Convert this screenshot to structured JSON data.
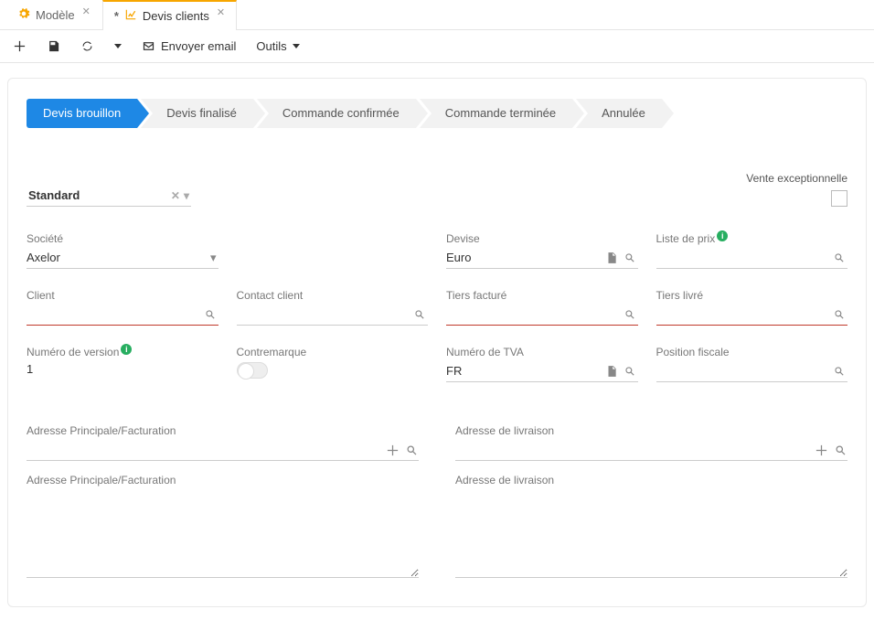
{
  "tabs": [
    {
      "label": "Modèle",
      "active": false,
      "icon": "gear"
    },
    {
      "label": "Devis clients",
      "active": true,
      "dirty_prefix": "*",
      "icon": "chart-line"
    }
  ],
  "toolbar": {
    "send_email": "Envoyer email",
    "tools": "Outils"
  },
  "workflow": [
    {
      "label": "Devis brouillon",
      "active": true
    },
    {
      "label": "Devis finalisé",
      "active": false
    },
    {
      "label": "Commande confirmée",
      "active": false
    },
    {
      "label": "Commande terminée",
      "active": false
    },
    {
      "label": "Annulée",
      "active": false
    }
  ],
  "header": {
    "standard_label": "Standard",
    "exceptional_sale_label": "Vente exceptionnelle"
  },
  "fields": {
    "company": {
      "label": "Société",
      "value": "Axelor"
    },
    "currency": {
      "label": "Devise",
      "value": "Euro"
    },
    "price_list": {
      "label": "Liste de prix",
      "value": ""
    },
    "client": {
      "label": "Client",
      "value": ""
    },
    "client_contact": {
      "label": "Contact client",
      "value": ""
    },
    "invoiced_third": {
      "label": "Tiers facturé",
      "value": ""
    },
    "delivered_third": {
      "label": "Tiers livré",
      "value": ""
    },
    "version_number": {
      "label": "Numéro de version",
      "value": "1"
    },
    "countermark": {
      "label": "Contremarque"
    },
    "vat_number": {
      "label": "Numéro de TVA",
      "value": "FR"
    },
    "fiscal_position": {
      "label": "Position fiscale",
      "value": ""
    }
  },
  "addresses": {
    "main_billing_header": "Adresse Principale/Facturation",
    "main_billing_label": "Adresse Principale/Facturation",
    "main_billing_value": "",
    "delivery_header": "Adresse de livraison",
    "delivery_label": "Adresse de livraison",
    "delivery_value": ""
  }
}
